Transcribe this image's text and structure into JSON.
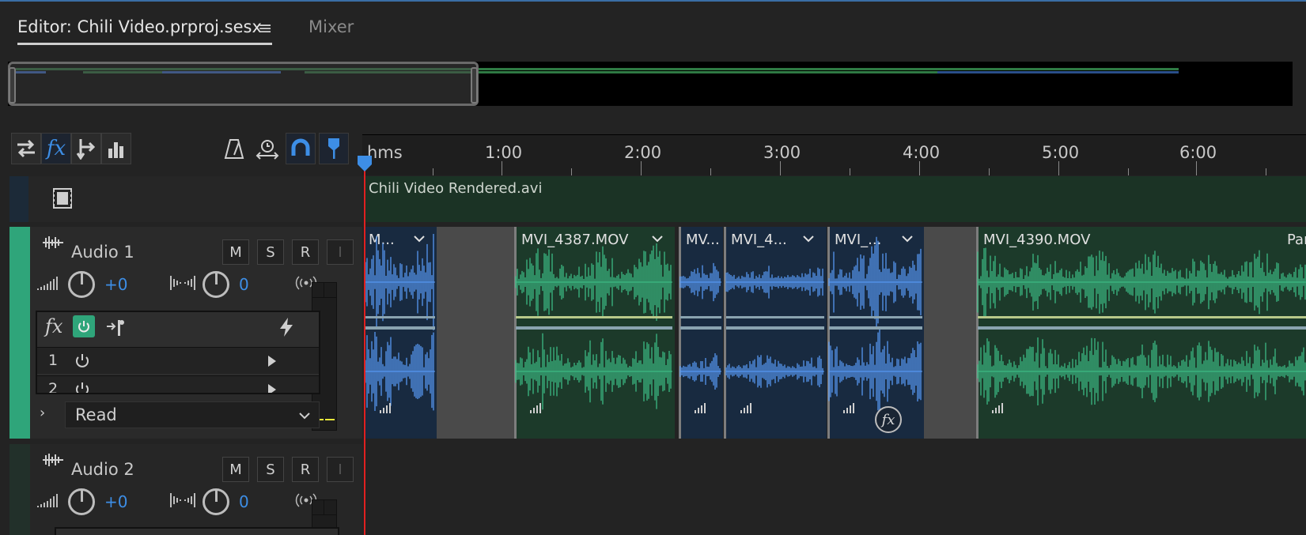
{
  "tabs": {
    "editor": "Editor: Chili Video.prproj.sesx",
    "menu_icon": "≡",
    "mixer": "Mixer"
  },
  "toolbar": {
    "left_icons": [
      "swap-icon",
      "fx-icon",
      "send-icon",
      "eq-bars-icon"
    ],
    "right_icons": [
      "metronome-icon",
      "stretch-icon",
      "snap-icon",
      "marker-icon"
    ]
  },
  "ruler": {
    "unit": "hms",
    "labels": [
      "1:00",
      "2:00",
      "3:00",
      "4:00",
      "5:00",
      "6:00"
    ]
  },
  "video_track": {
    "clip_name": "Chili Video Rendered.avi"
  },
  "audio1": {
    "name": "Audio 1",
    "buttons": [
      "M",
      "S",
      "R",
      "I"
    ],
    "volume": "+0",
    "pan": "0",
    "fx_label": "fx",
    "rack_rows": [
      "1",
      "2"
    ],
    "automation": "Read",
    "clips": [
      {
        "name": "M...",
        "color": "blue"
      },
      {
        "name": "MVI_4387.MOV",
        "color": "green"
      },
      {
        "name": "MV...",
        "color": "blue"
      },
      {
        "name": "MVI_4...",
        "color": "blue"
      },
      {
        "name": "MVI_...",
        "color": "blue"
      },
      {
        "name": "MVI_4390.MOV",
        "color": "green"
      },
      {
        "name": "Par",
        "color": "green"
      }
    ],
    "clip_fx_badge": "fx"
  },
  "audio2": {
    "name": "Audio 2",
    "buttons": [
      "M",
      "S",
      "R",
      "I"
    ],
    "volume": "+0",
    "pan": "0"
  },
  "colors": {
    "accent_blue": "#3d8ee6",
    "track_green": "#2fa57a",
    "playhead": "#e02020",
    "wave_blue": "#5aa0ff",
    "wave_green": "#3ec48a"
  }
}
